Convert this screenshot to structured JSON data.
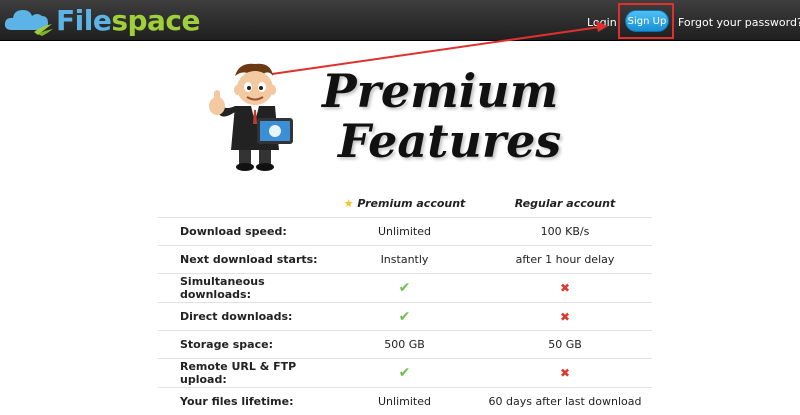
{
  "header": {
    "logo_part1": "File",
    "logo_part2": "space",
    "login_label": "Login",
    "signup_label": "Sign Up",
    "forgot_label": "Forgot your password?"
  },
  "hero": {
    "line1": "Premium",
    "line2": "Features"
  },
  "comparison": {
    "columns": [
      "Premium account",
      "Regular account"
    ],
    "rows": [
      {
        "label": "Download speed:",
        "premium": "Unlimited",
        "regular": "100 KB/s"
      },
      {
        "label": "Next download starts:",
        "premium": "Instantly",
        "regular": "after 1 hour delay"
      },
      {
        "label": "Simultaneous downloads:",
        "premium": "check",
        "regular": "cross"
      },
      {
        "label": "Direct downloads:",
        "premium": "check",
        "regular": "cross"
      },
      {
        "label": "Storage space:",
        "premium": "500 GB",
        "regular": "50 GB"
      },
      {
        "label": "Remote URL & FTP upload:",
        "premium": "check",
        "regular": "cross"
      },
      {
        "label": "Your files lifetime:",
        "premium": "Unlimited",
        "regular": "60 days after last download"
      }
    ]
  },
  "colors": {
    "topbar": "#2b2b2b",
    "accent_blue": "#2aa6ea",
    "highlight_red": "#e0302e",
    "check_green": "#6cc04a"
  }
}
